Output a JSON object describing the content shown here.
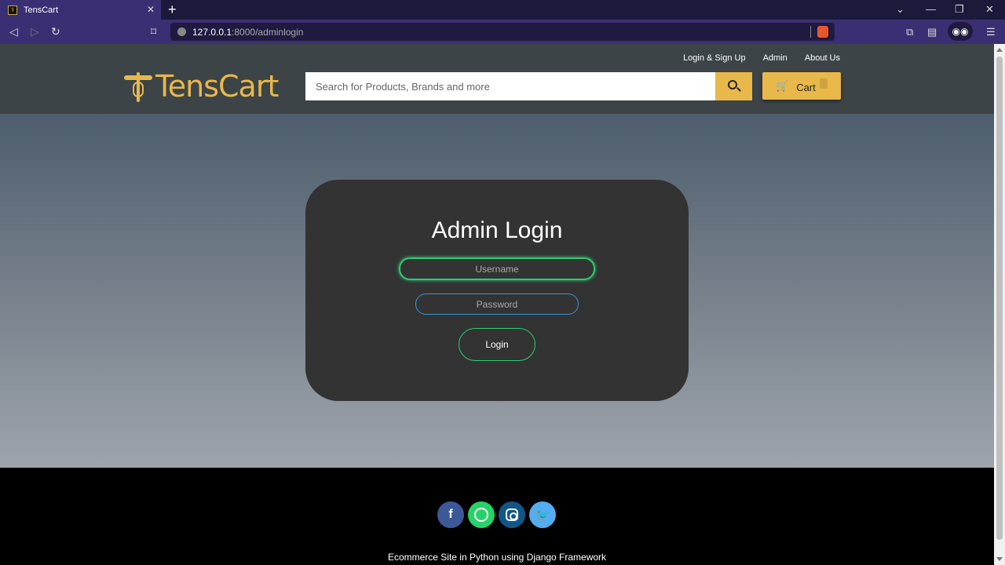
{
  "browser": {
    "tab_title": "TensCart",
    "url_host": "127.0.0.1",
    "url_path": ":8000/adminlogin"
  },
  "header": {
    "links": [
      "Login & Sign Up",
      "Admin",
      "About Us"
    ],
    "brand": "TensCart",
    "search_placeholder": "Search for Products, Brands and more",
    "cart_label": "Cart"
  },
  "login": {
    "title": "Admin Login",
    "username_placeholder": "Username",
    "password_placeholder": "Password",
    "button_label": "Login"
  },
  "footer": {
    "text": "Ecommerce Site in Python using Django Framework",
    "socials": [
      "facebook",
      "whatsapp",
      "instagram",
      "twitter"
    ]
  },
  "colors": {
    "accent": "#e8b84a",
    "header_bg": "#3d4448",
    "card_bg": "#333333",
    "green": "#2ecc71",
    "blue": "#3498db"
  }
}
